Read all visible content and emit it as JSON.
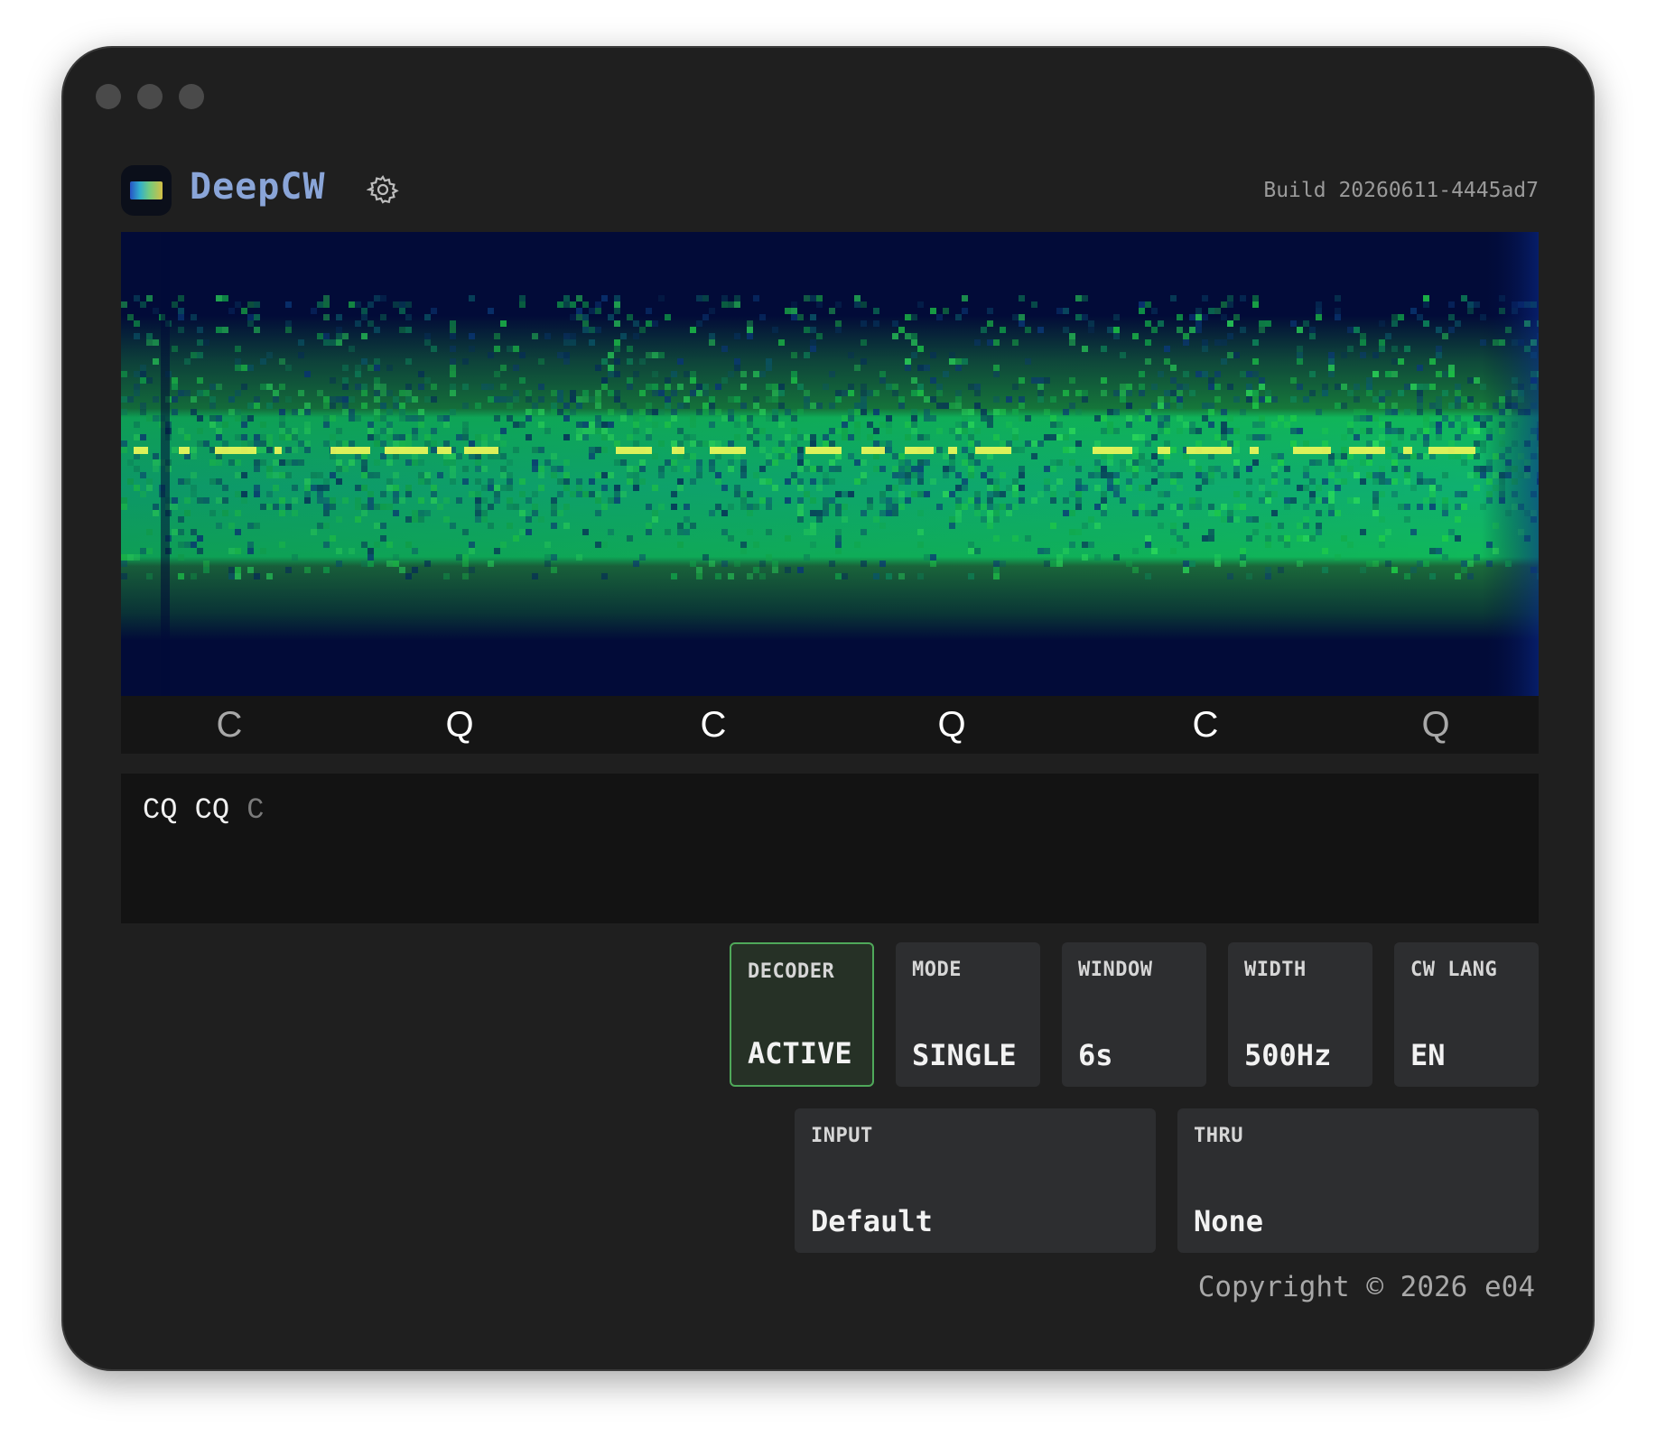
{
  "app": {
    "title": "DeepCW",
    "build": "Build 20260611-4445ad7",
    "copyright": "Copyright © 2026 e04"
  },
  "decoded_letters": [
    {
      "char": "C",
      "state": "dim"
    },
    {
      "char": "Q",
      "state": "bright"
    },
    {
      "char": "C",
      "state": "bright"
    },
    {
      "char": "Q",
      "state": "bright"
    },
    {
      "char": "C",
      "state": "bright"
    },
    {
      "char": "Q",
      "state": "dim"
    }
  ],
  "transcript": {
    "committed": "CQ CQ",
    "pending": "C"
  },
  "controls": {
    "decoder": {
      "label": "DECODER",
      "value": "ACTIVE"
    },
    "mode": {
      "label": "MODE",
      "value": "SINGLE"
    },
    "window": {
      "label": "WINDOW",
      "value": "6s"
    },
    "width": {
      "label": "WIDTH",
      "value": "500Hz"
    },
    "cw_lang": {
      "label": "CW LANG",
      "value": "EN"
    },
    "input": {
      "label": "INPUT",
      "value": "Default"
    },
    "thru": {
      "label": "THRU",
      "value": "None"
    }
  },
  "colors": {
    "accent_active": "#4fa85a",
    "spectrogram_background": "#020b38",
    "signal": "#e8f55a",
    "title": "#8aa5d8"
  },
  "icons": {
    "settings": "gear-icon",
    "app": "spectrogram-app-icon"
  }
}
